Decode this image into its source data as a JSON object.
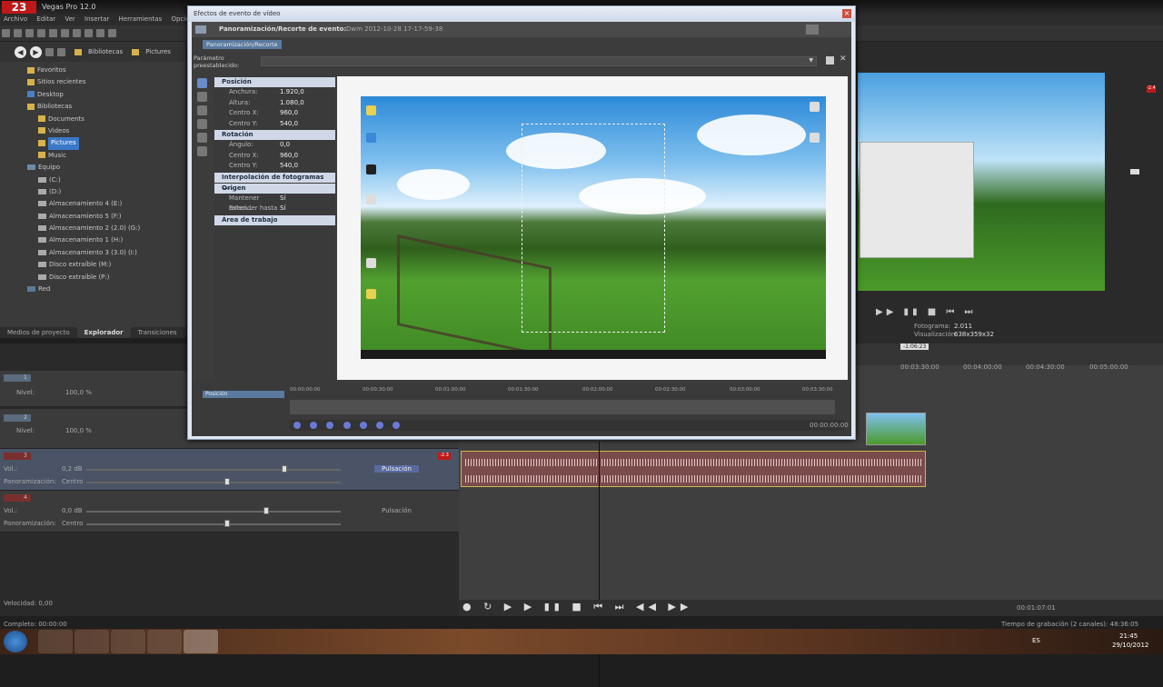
{
  "app": {
    "title": "Vegas Pro 12.0",
    "logo_text": "23",
    "menu": [
      "Archivo",
      "Editar",
      "Ver",
      "Insertar",
      "Herramientas",
      "Opciones"
    ]
  },
  "explorer": {
    "breadcrumb": [
      "Bibliotecas",
      "Pictures"
    ],
    "tree": [
      {
        "label": "Favoritos",
        "icon": "folder-icon"
      },
      {
        "label": "Sitios recientes",
        "icon": "folder-icon"
      },
      {
        "label": "Desktop",
        "icon": "folder-icon"
      },
      {
        "label": "Bibliotecas",
        "icon": "folder-icon"
      },
      {
        "label": "Documents",
        "icon": "folder-icon"
      },
      {
        "label": "Videos",
        "icon": "folder-icon"
      },
      {
        "label": "Pictures",
        "icon": "folder-icon",
        "selected": true
      },
      {
        "label": "Music",
        "icon": "folder-icon"
      },
      {
        "label": "Equipo",
        "icon": "computer-icon"
      },
      {
        "label": "(C:)",
        "icon": "drive-icon"
      },
      {
        "label": "(D:)",
        "icon": "drive-icon"
      },
      {
        "label": "Almacenamiento 4 (E:)",
        "icon": "drive-icon"
      },
      {
        "label": "Almacenamiento 5 (F:)",
        "icon": "drive-icon"
      },
      {
        "label": "Almacenamiento 2 (2.0) (G:)",
        "icon": "drive-icon"
      },
      {
        "label": "Almacenamiento 1 (H:)",
        "icon": "drive-icon"
      },
      {
        "label": "Almacenamiento 3 (3.0) (I:)",
        "icon": "drive-icon"
      },
      {
        "label": "Disco extraíble (M:)",
        "icon": "drive-icon"
      },
      {
        "label": "Disco extraíble (P:)",
        "icon": "drive-icon"
      },
      {
        "label": "Red",
        "icon": "network-icon"
      }
    ],
    "tabs": [
      "Medios de proyecto",
      "Explorador",
      "Transiciones"
    ],
    "active_tab": "Explorador"
  },
  "tracks": {
    "video": [
      {
        "num": "1",
        "level_label": "Nivel:",
        "level_value": "100,0 %"
      },
      {
        "num": "2",
        "level_label": "Nivel:",
        "level_value": "100,0 %"
      }
    ],
    "audio": [
      {
        "num": "3",
        "vol_label": "Vol.:",
        "vol_value": "0,2 dB",
        "pan_label": "Panoramización:",
        "pan_value": "Centro",
        "mode": "Pulsación",
        "meter": "-2.3"
      },
      {
        "num": "4",
        "vol_label": "Vol.:",
        "vol_value": "0,0 dB",
        "pan_label": "Panoramización:",
        "pan_value": "Centro",
        "mode": "Pulsación"
      }
    ]
  },
  "timeline": {
    "ruler": [
      "00:03:30:00",
      "00:04:00:00",
      "00:04:30:00",
      "00:05:00:00"
    ],
    "marker": "-1:06:23"
  },
  "preview": {
    "frame_label": "Fotograma:",
    "frame_value": "2.011",
    "display_label": "Visualización:",
    "display_value": "638x359x32",
    "meter_value": "-2.4"
  },
  "transport": {
    "time": "00:01:07:01",
    "rate_label": "Velocidad: 0,00"
  },
  "status": {
    "left": "Completo: 00:00:00",
    "right": "Tiempo de grabación (2 canales): 48:36:05"
  },
  "taskbar": {
    "lang": "ES",
    "time": "21:45",
    "date": "29/10/2012"
  },
  "dialog": {
    "title": "Efectos de evento de vídeo",
    "header_label": "Panoramización/Recorte de evento:",
    "header_value": "Dwm 2012-10-28 17-17-59-38",
    "tab": "Panoramización/Recorte",
    "preset_label": "Parámetro preestablecido:",
    "groups": [
      {
        "title": "Posición",
        "rows": [
          [
            "Anchura:",
            "1.920,0"
          ],
          [
            "Altura:",
            "1.080,0"
          ],
          [
            "Centro X:",
            "960,0"
          ],
          [
            "Centro Y:",
            "540,0"
          ]
        ]
      },
      {
        "title": "Rotación",
        "rows": [
          [
            "Ángulo:",
            "0,0"
          ],
          [
            "Centro X:",
            "960,0"
          ],
          [
            "Centro Y:",
            "540,0"
          ]
        ]
      },
      {
        "title": "Interpolación de fotogramas c...",
        "rows": []
      },
      {
        "title": "Origen",
        "rows": [
          [
            "Mantener relaci...",
            "Sí"
          ],
          [
            "Extender hasta ...",
            "Sí"
          ]
        ]
      },
      {
        "title": "Área de trabajo",
        "rows": []
      }
    ],
    "keyframe_track": "Posición",
    "ruler": [
      "00:00:00:00",
      "00:00:30:00",
      "00:01:00:00",
      "00:01:30:00",
      "00:02:00:00",
      "00:02:30:00",
      "00:03:00:00",
      "00:03:30:00"
    ],
    "end_time": "00:00:00:00"
  }
}
